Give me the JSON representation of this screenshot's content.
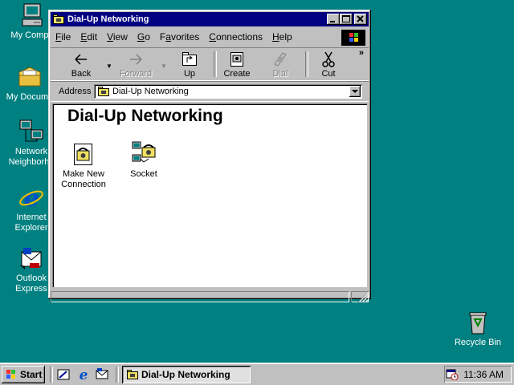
{
  "desktop": {
    "icons": [
      {
        "label": "My Compu"
      },
      {
        "label": "My Docume"
      },
      {
        "label": "Network\nNeighborho"
      },
      {
        "label": "Internet\nExplorer"
      },
      {
        "label": "Outlook\nExpress"
      },
      {
        "label": "Recycle Bin"
      }
    ]
  },
  "window": {
    "title": "Dial-Up Networking",
    "menu": [
      "File",
      "Edit",
      "View",
      "Go",
      "Favorites",
      "Connections",
      "Help"
    ],
    "menu_underline": [
      "F",
      "E",
      "V",
      "G",
      "a",
      "C",
      "H"
    ],
    "toolbar": {
      "back": "Back",
      "forward": "Forward",
      "up": "Up",
      "create": "Create",
      "dial": "Dial",
      "cut": "Cut",
      "more": "»"
    },
    "address_label": "Address",
    "address_value": "Dial-Up Networking",
    "folder_title": "Dial-Up Networking",
    "items": [
      {
        "label": "Make New\nConnection"
      },
      {
        "label": "Socket"
      }
    ]
  },
  "taskbar": {
    "start_label": "Start",
    "task_label": "Dial-Up Networking",
    "clock": "11:36 AM"
  },
  "colors": {
    "desktop": "#008080",
    "titlebar": "#000080",
    "face": "#c0c0c0"
  }
}
